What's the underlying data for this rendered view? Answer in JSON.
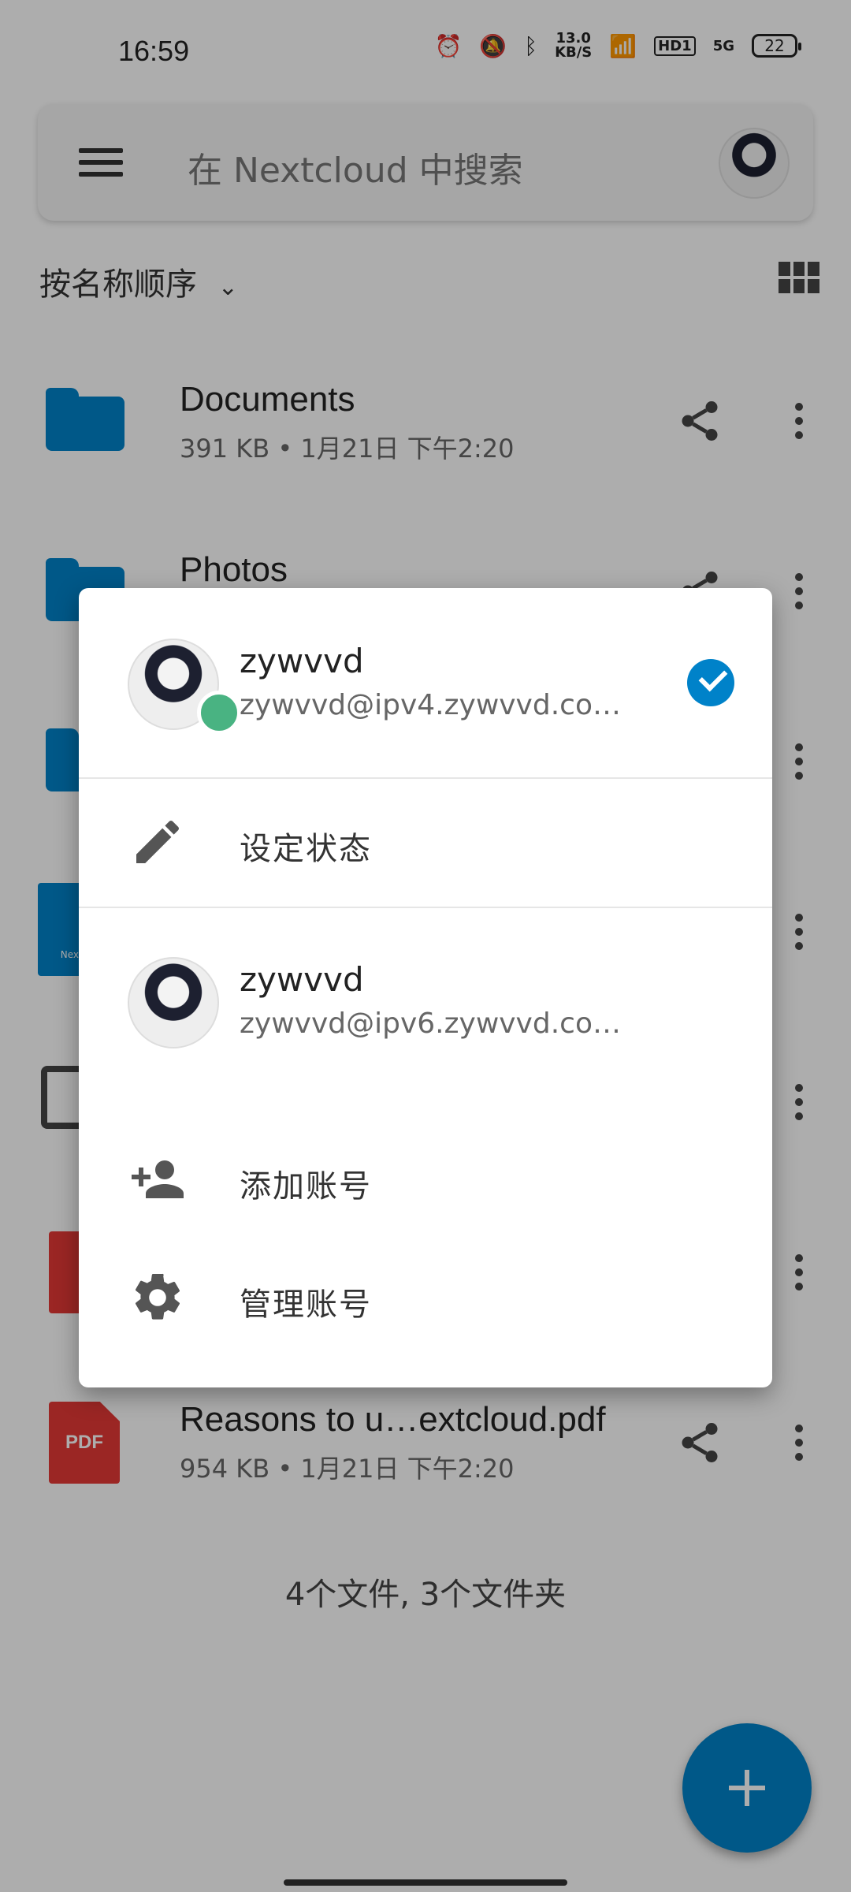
{
  "status_bar": {
    "time": "16:59",
    "network_speed": "13.0",
    "network_unit": "KB/S",
    "hd_badge": "HD1",
    "signal_label": "5G",
    "battery": "22"
  },
  "search": {
    "placeholder": "在 Nextcloud 中搜索"
  },
  "sort": {
    "label": "按名称顺序"
  },
  "files": [
    {
      "name": "Documents",
      "meta": "391 KB • 1月21日 下午2:20",
      "type": "folder"
    },
    {
      "name": "Photos",
      "meta": "",
      "type": "folder"
    },
    {
      "name": "",
      "meta": "",
      "type": "folder"
    },
    {
      "name": "",
      "meta": "",
      "type": "nextcloud-image"
    },
    {
      "name": "",
      "meta": "",
      "type": "video"
    },
    {
      "name": "",
      "meta": "",
      "type": "pdf"
    },
    {
      "name": "Reasons to u…extcloud.pdf",
      "meta": "954 KB • 1月21日 下午2:20",
      "type": "pdf"
    }
  ],
  "thumb_labels": {
    "pdf": "PDF",
    "pdf_partial": "P",
    "nextcloud": "Nextc"
  },
  "footer": {
    "count": "4个文件, 3个文件夹"
  },
  "account_dialog": {
    "accounts": [
      {
        "name": "zywvvd",
        "server": "zywvvd@ipv4.zywvvd.co…",
        "selected": true,
        "status": "online"
      },
      {
        "name": "zywvvd",
        "server": "zywvvd@ipv6.zywvvd.co…",
        "selected": false
      }
    ],
    "set_status": "设定状态",
    "add_account": "添加账号",
    "manage_accounts": "管理账号"
  },
  "colors": {
    "brand": "#0082c9",
    "online": "#49b382",
    "pdf": "#e53935"
  }
}
